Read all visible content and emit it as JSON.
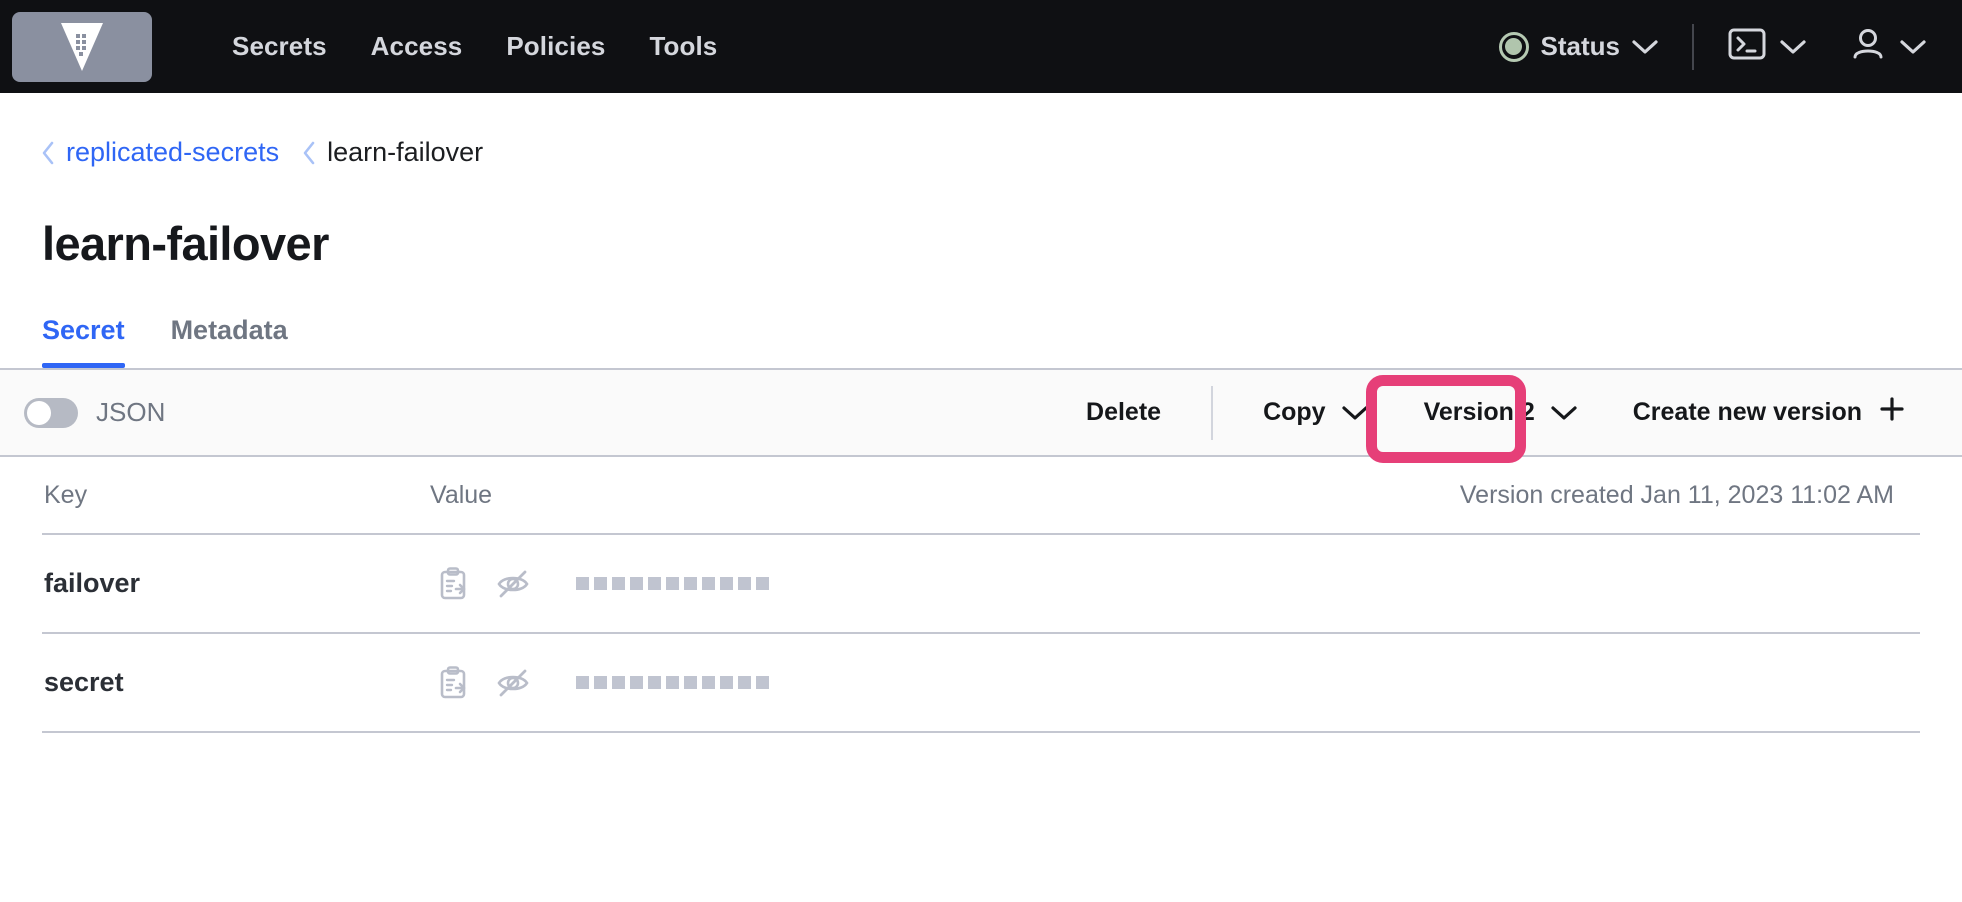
{
  "navbar": {
    "logo_icon": "vault-logo-icon",
    "links": [
      {
        "label": "Secrets"
      },
      {
        "label": "Access"
      },
      {
        "label": "Policies"
      },
      {
        "label": "Tools"
      }
    ],
    "status": {
      "label": "Status",
      "indicator_color": "#b0c5ad",
      "chevron_icon": "chevron-down-icon"
    },
    "console_icon": "terminal-icon",
    "console_chevron_icon": "chevron-down-icon",
    "user_icon": "user-icon",
    "user_chevron_icon": "chevron-down-icon"
  },
  "breadcrumb": {
    "chevron_icon": "chevron-left-icon",
    "parent": "replicated-secrets",
    "current": "learn-failover"
  },
  "header": {
    "title": "learn-failover"
  },
  "tabs": [
    {
      "label": "Secret",
      "active": true
    },
    {
      "label": "Metadata",
      "active": false
    }
  ],
  "toolbar": {
    "json_toggle_label": "JSON",
    "json_toggle_on": false,
    "delete_label": "Delete",
    "copy_label": "Copy",
    "copy_chevron_icon": "chevron-down-icon",
    "version_label": "Version 2",
    "version_chevron_icon": "chevron-down-icon",
    "create_label": "Create new version",
    "create_icon": "plus-icon",
    "highlight_color": "#e63f78"
  },
  "table": {
    "columns": {
      "key": "Key",
      "value": "Value",
      "version_created": "Version created Jan 11, 2023 11:02 AM"
    },
    "rows": [
      {
        "key": "failover",
        "copy_icon": "copy-to-clipboard-icon",
        "reveal_icon": "eye-off-icon",
        "masked_value": "■■■■■■■■■■■",
        "mask_count": 11
      },
      {
        "key": "secret",
        "copy_icon": "copy-to-clipboard-icon",
        "reveal_icon": "eye-off-icon",
        "masked_value": "■■■■■■■■■■■",
        "mask_count": 11
      }
    ]
  }
}
